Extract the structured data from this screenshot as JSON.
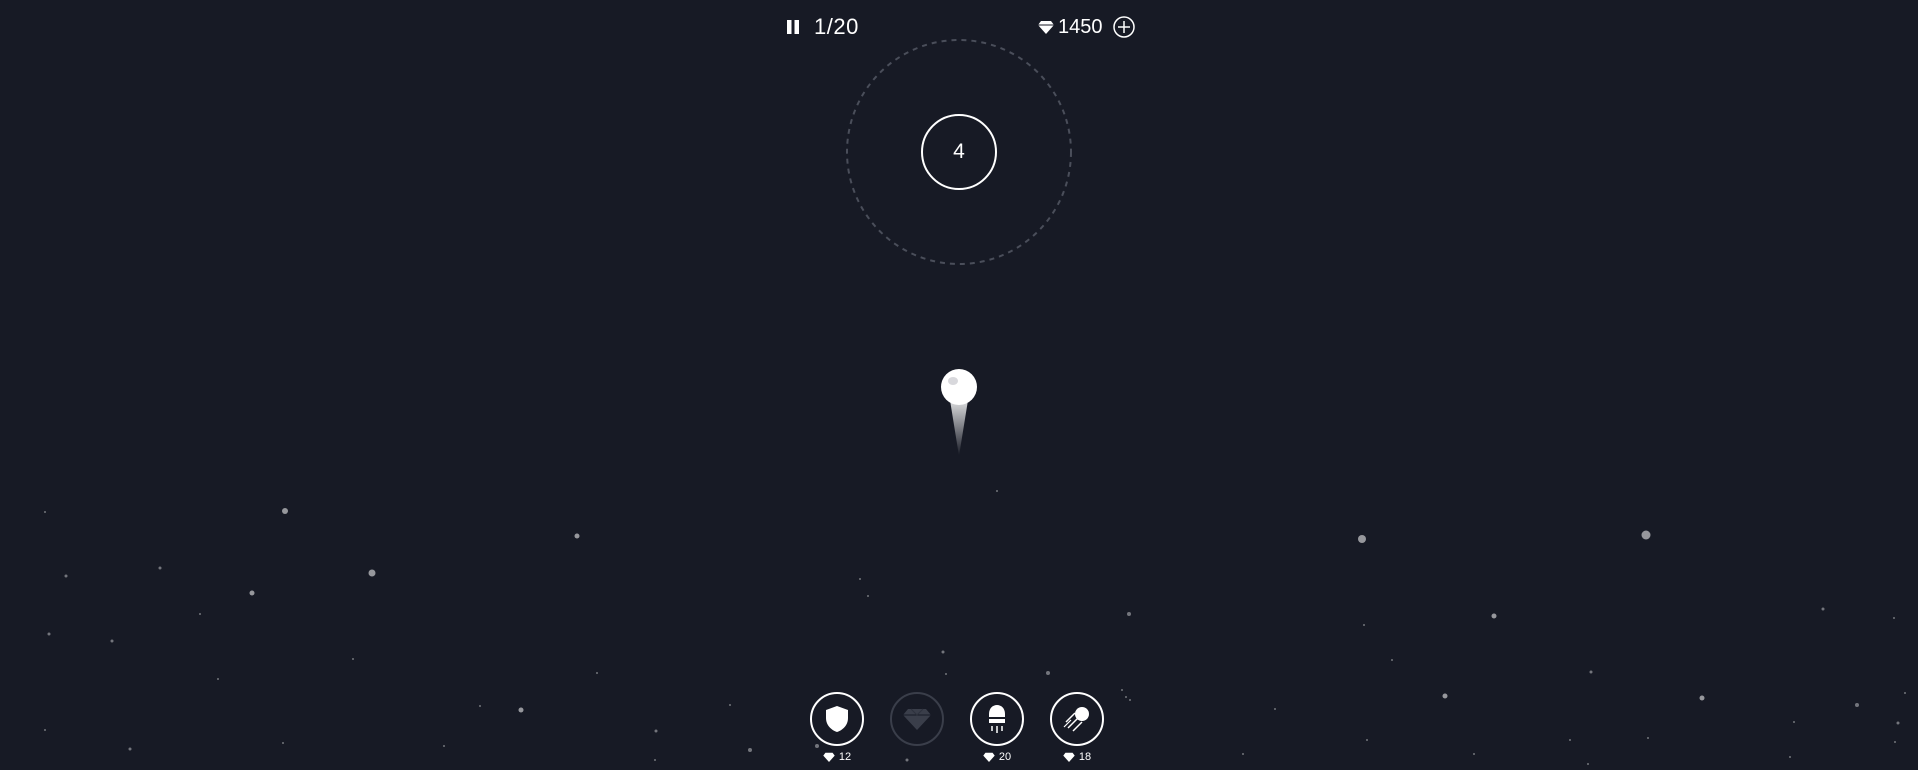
{
  "hud": {
    "wave": "1/20",
    "gems": "1450"
  },
  "target": {
    "hits_remaining": "4"
  },
  "powerups": [
    {
      "name": "shield",
      "cost": "12",
      "enabled": true
    },
    {
      "name": "gem",
      "cost": "",
      "enabled": false
    },
    {
      "name": "rocket",
      "cost": "20",
      "enabled": true
    },
    {
      "name": "comet",
      "cost": "18",
      "enabled": true
    }
  ],
  "colors": {
    "background": "#171a25",
    "foreground": "#ffffff",
    "disabled": "#3a3e4a",
    "dashed_ring": "#4a4e5a"
  }
}
